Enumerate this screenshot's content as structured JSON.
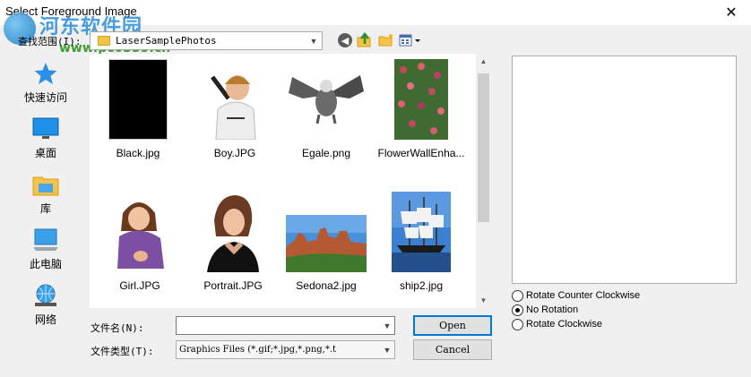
{
  "window": {
    "title": "Select Foreground Image",
    "close_glyph": "✕"
  },
  "watermark": {
    "title": "河东软件园",
    "url": "www.pc0359.cn"
  },
  "toolbar": {
    "look_in_label": "查找范围(I):",
    "look_in_value": "LaserSamplePhotos",
    "back_icon": "back-arrow-icon",
    "up_icon": "up-folder-icon",
    "new_folder_icon": "new-folder-icon",
    "views_icon": "view-menu-icon"
  },
  "places": [
    {
      "label": "快速访问",
      "icon": "quick-access-star-icon"
    },
    {
      "label": "桌面",
      "icon": "desktop-icon"
    },
    {
      "label": "库",
      "icon": "libraries-icon"
    },
    {
      "label": "此电脑",
      "icon": "this-pc-icon"
    },
    {
      "label": "网络",
      "icon": "network-icon"
    }
  ],
  "files": [
    {
      "name": "Black.jpg"
    },
    {
      "name": "Boy.JPG"
    },
    {
      "name": "Egale.png"
    },
    {
      "name": "FlowerWallEnha..."
    },
    {
      "name": "Girl.JPG"
    },
    {
      "name": "Portrait.JPG"
    },
    {
      "name": "Sedona2.jpg"
    },
    {
      "name": "ship2.jpg"
    }
  ],
  "rotation": {
    "options": [
      "Rotate Counter Clockwise",
      "No Rotation",
      "Rotate Clockwise"
    ],
    "selected": "No Rotation"
  },
  "form": {
    "filename_label": "文件名(N):",
    "filename_value": "",
    "filetype_label": "文件类型(T):",
    "filetype_value": "Graphics Files (*.gif;*.jpg,*.png,*.t"
  },
  "buttons": {
    "open": "Open",
    "cancel": "Cancel"
  },
  "colors": {
    "accent": "#0078d7",
    "watermark_blue": "#2f8fdb",
    "watermark_green": "#3c9e2e"
  }
}
